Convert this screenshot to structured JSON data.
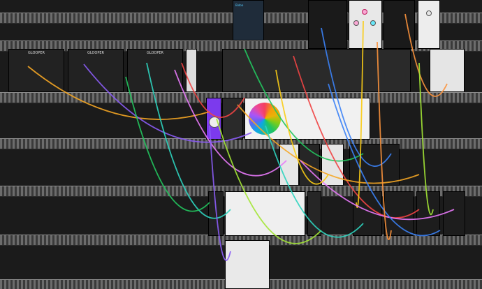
{
  "rack": {
    "row_count": 6,
    "modules": [
      {
        "kind": "looper",
        "title": "GLOOPER",
        "theme": "dark"
      },
      {
        "kind": "looper",
        "title": "GLOOPER",
        "theme": "dark"
      },
      {
        "kind": "looper",
        "title": "GLOOPER",
        "theme": "dark"
      },
      {
        "kind": "utility",
        "title": "",
        "theme": "light"
      },
      {
        "kind": "mixer",
        "title": "",
        "theme": "dark"
      },
      {
        "kind": "sequencer",
        "title": "",
        "theme": "light"
      },
      {
        "kind": "filter",
        "title": "",
        "theme": "purple"
      },
      {
        "kind": "oscillator",
        "title": "",
        "theme": "dark"
      },
      {
        "kind": "oscillator",
        "title": "",
        "theme": "light"
      },
      {
        "kind": "envelope",
        "title": "",
        "theme": "dark"
      },
      {
        "kind": "envelope",
        "title": "",
        "theme": "dark"
      },
      {
        "kind": "envelope",
        "title": "",
        "theme": "dark"
      },
      {
        "kind": "quantizer",
        "title": "",
        "theme": "light"
      },
      {
        "kind": "vca",
        "title": "",
        "theme": "dark"
      },
      {
        "kind": "reverb",
        "title": "",
        "theme": "light"
      }
    ]
  },
  "colors": {
    "rail": "#6c6c6c",
    "background": "#121212",
    "cable_palette": [
      "#f5a623",
      "#8b5cf6",
      "#2dd4bf",
      "#e879f9",
      "#22c55e",
      "#ef4444",
      "#3b82f6",
      "#facc15",
      "#fb923c",
      "#a3e635"
    ]
  },
  "labels": {
    "sequencer_circle": "circle-of-fifths",
    "top_banner_text": "Bidoo"
  }
}
